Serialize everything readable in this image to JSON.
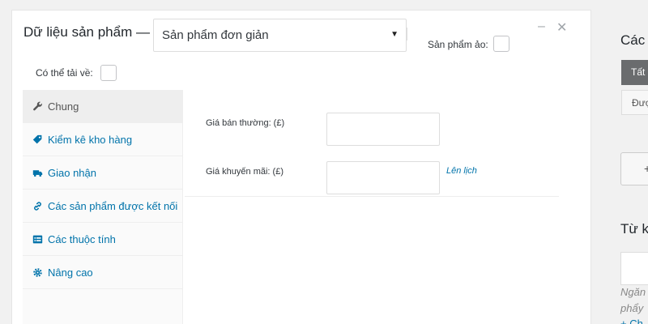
{
  "header": {
    "title": "Dữ liệu sản phẩm —",
    "product_type_value": "Sản phẩm đơn giản",
    "virtual_label": "Sản phẩm ảo:",
    "downloadable_label": "Có thể tải về:",
    "collapse_glyph": "–",
    "close_glyph": "✕",
    "select_arrow": "▼"
  },
  "tabs": [
    {
      "label": "Chung",
      "icon": "wrench-icon"
    },
    {
      "label": "Kiểm kê kho hàng",
      "icon": "tag-icon"
    },
    {
      "label": "Giao nhận",
      "icon": "truck-icon"
    },
    {
      "label": "Các sản phẩm được kết nối",
      "icon": "link-icon"
    },
    {
      "label": "Các thuộc tính",
      "icon": "list-icon"
    },
    {
      "label": "Nâng cao",
      "icon": "gear-icon"
    }
  ],
  "general": {
    "regular_price_label": "Giá bán thường: (£)",
    "regular_price_value": "",
    "sale_price_label": "Giá khuyến mãi: (£)",
    "sale_price_value": "",
    "schedule_link": "Lên lịch"
  },
  "right_sidebar": {
    "categories_title": "Các d",
    "tab_all": "Tất",
    "tab_used": "Đượ",
    "add_button": "+",
    "tags_title": "Từ k",
    "tag_input_value": "",
    "help_line1": "Ngăn",
    "help_line2": "phẩy",
    "help_line3": "+ Ch"
  },
  "colors": {
    "link": "#0073aa",
    "active_tab_bg": "#eeeeee",
    "panel_bg": "#ffffff",
    "page_bg": "#f1f1f1"
  }
}
